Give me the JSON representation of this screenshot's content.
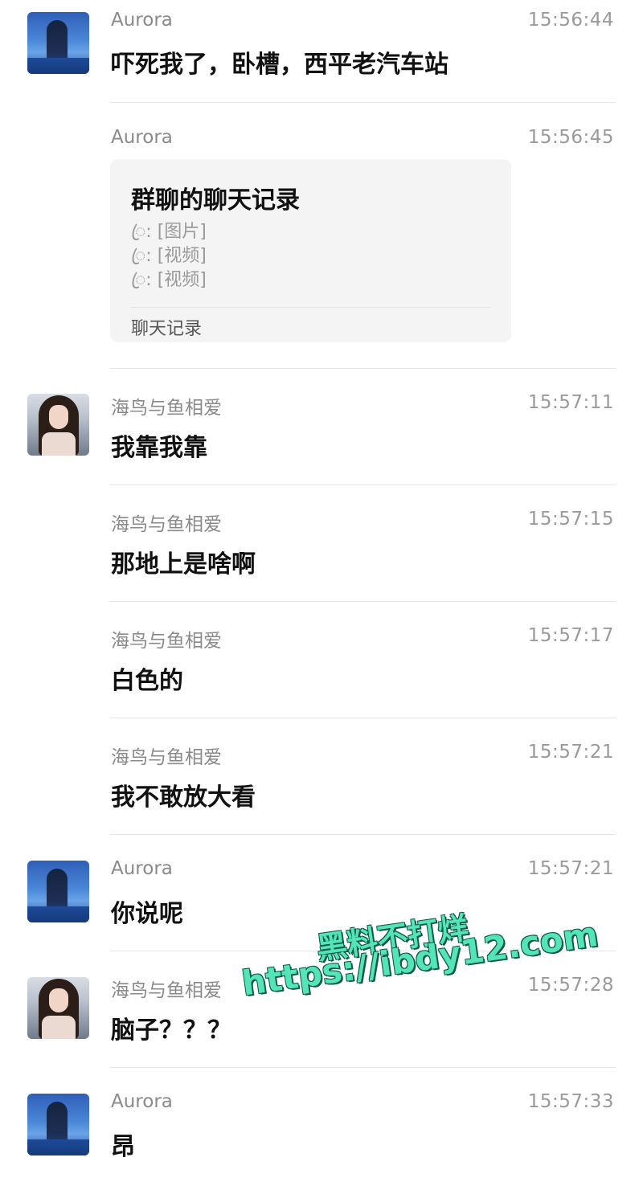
{
  "messages": [
    {
      "sender": "Aurora",
      "time": "15:56:44",
      "text": "吓死我了，卧槽，西平老汽车站",
      "avatar": "aurora-avatar"
    },
    {
      "sender": "Aurora",
      "time": "15:56:45",
      "text": "",
      "avatar": null
    },
    {
      "sender": "海鸟与鱼相爱",
      "time": "15:57:11",
      "text": "我靠我靠",
      "avatar": "girl-avatar"
    },
    {
      "sender": "海鸟与鱼相爱",
      "time": "15:57:15",
      "text": "那地上是啥啊",
      "avatar": null
    },
    {
      "sender": "海鸟与鱼相爱",
      "time": "15:57:17",
      "text": "白色的",
      "avatar": null
    },
    {
      "sender": "海鸟与鱼相爱",
      "time": "15:57:21",
      "text": "我不敢放大看",
      "avatar": null
    },
    {
      "sender": "Aurora",
      "time": "15:57:21",
      "text": "你说呢",
      "avatar": "aurora-avatar"
    },
    {
      "sender": "海鸟与鱼相爱",
      "time": "15:57:28",
      "text": "脑子？？？",
      "avatar": "girl-avatar"
    },
    {
      "sender": "Aurora",
      "time": "15:57:33",
      "text": "昂",
      "avatar": "aurora-avatar"
    }
  ],
  "chat_record_card": {
    "title": "群聊的聊天记录",
    "lines": [
      "ꦿ: [图片]",
      "ꦿ: [视频]",
      "ꦿ: [视频]"
    ],
    "footer": "聊天记录"
  },
  "watermark": {
    "line1": "黑料不打烊",
    "line2": "https://ibdy12.com",
    "color": "#55e3b8"
  }
}
